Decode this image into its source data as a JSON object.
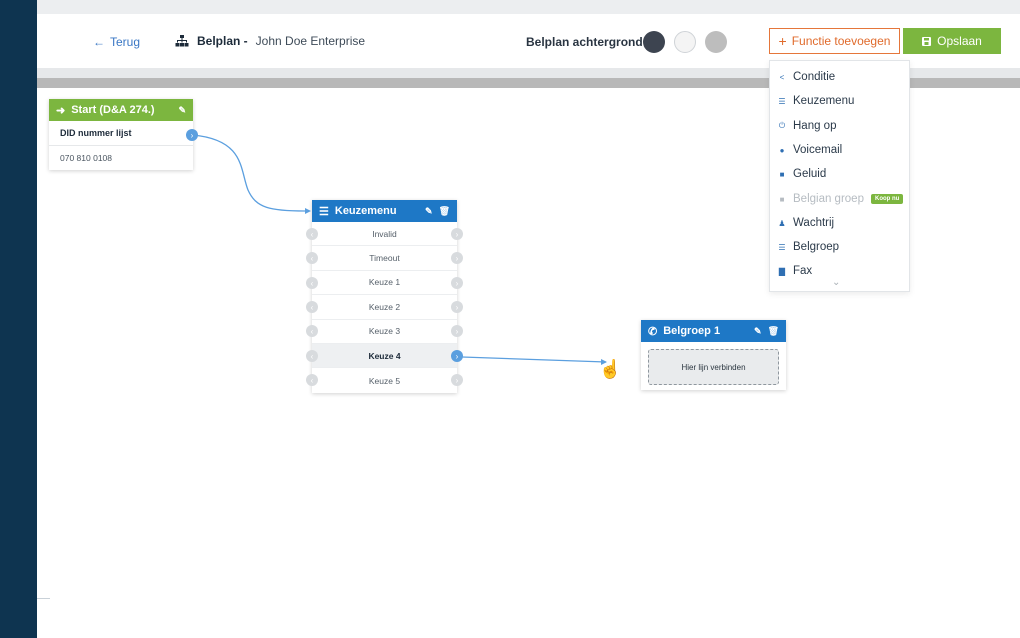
{
  "header": {
    "back_label": "Terug",
    "plan_label": "Belplan -",
    "plan_company": "John Doe Enterprise",
    "background_label": "Belplan achtergrond",
    "swatches": [
      "#3d4450",
      "#f4f4f4",
      "#bdbdbd"
    ],
    "add_function_label": "Functie toevoegen",
    "save_label": "Opslaan"
  },
  "dropdown": {
    "items": [
      {
        "label": "Conditie",
        "icon": "share-icon"
      },
      {
        "label": "Keuzemenu",
        "icon": "list-icon"
      },
      {
        "label": "Hang op",
        "icon": "power-icon"
      },
      {
        "label": "Voicemail",
        "icon": "microphone-icon"
      },
      {
        "label": "Geluid",
        "icon": "file-audio-icon"
      },
      {
        "label": "Belgian groep",
        "icon": "file-icon",
        "disabled": true,
        "badge": "Koop nu"
      },
      {
        "label": "Wachtrij",
        "icon": "users-icon"
      },
      {
        "label": "Belgroep",
        "icon": "list-icon"
      },
      {
        "label": "Fax",
        "icon": "fax-icon"
      }
    ]
  },
  "start_node": {
    "title": "Start (D&A 274.)",
    "row_title": "DID nummer lijst",
    "number": "070 810 0108"
  },
  "menu_node": {
    "title": "Keuzemenu",
    "options": [
      "Invalid",
      "Timeout",
      "Keuze 1",
      "Keuze 2",
      "Keuze 3",
      "Keuze 4",
      "Keuze 5"
    ],
    "active_option": "Keuze 4"
  },
  "belgroep_node": {
    "title": "Belgroep 1",
    "drop_label": "Hier lijn verbinden"
  },
  "colors": {
    "sidebar": "#0e3450",
    "accent_green": "#7cb63f",
    "accent_blue": "#1e78c6",
    "accent_orange": "#e06a2b"
  }
}
